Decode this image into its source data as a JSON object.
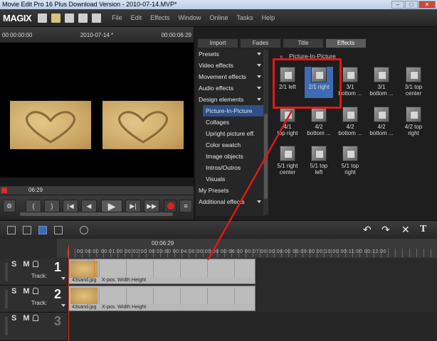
{
  "window": {
    "title": "Movie Edit Pro 16 Plus Download Version - 2010-07-14.MVP*",
    "controls": [
      "–",
      "□",
      "✕"
    ]
  },
  "app": {
    "logo": "MAGIX"
  },
  "menu": [
    "File",
    "Edit",
    "Effects",
    "Window",
    "Online",
    "Tasks",
    "Help"
  ],
  "preview": {
    "time_left": "00:00:00:00",
    "project_name": "2010-07-14 *",
    "time_right": "00:00:06:29",
    "scrub_time": "06:29"
  },
  "controls": {
    "buttons": [
      "{",
      "}",
      "|◀",
      "◀",
      "▶",
      "▶|",
      "▶▶",
      "●",
      "≡"
    ]
  },
  "browser": {
    "tabs": [
      "Import",
      "Fades",
      "Title",
      "Effects"
    ],
    "active_tab": "Effects",
    "categories": [
      {
        "label": "Presets",
        "sub": false,
        "expandable": true
      },
      {
        "label": "Video effects",
        "sub": false,
        "expandable": true
      },
      {
        "label": "Movement effects",
        "sub": false,
        "expandable": true
      },
      {
        "label": "Audio effects",
        "sub": false,
        "expandable": true
      },
      {
        "label": "Design elements",
        "sub": false,
        "expandable": true
      },
      {
        "label": "Picture-In-Picture",
        "sub": true,
        "selected": true
      },
      {
        "label": "Collages",
        "sub": true
      },
      {
        "label": "Upright picture eff.",
        "sub": true
      },
      {
        "label": "Color swatch",
        "sub": true
      },
      {
        "label": "Image objects",
        "sub": true
      },
      {
        "label": "Intros/Outros",
        "sub": true
      },
      {
        "label": "Visuals",
        "sub": true
      },
      {
        "label": "My Presets",
        "sub": false
      },
      {
        "label": "Additional effects",
        "sub": false,
        "expandable": true
      }
    ],
    "section_title": "Picture-In-Picture",
    "effects": [
      [
        "2/1 left"
      ],
      [
        "2/1 right"
      ],
      [
        "3/1",
        "bottom ..."
      ],
      [
        "3/1",
        "bottom ..."
      ],
      [
        "3/1 top",
        "center"
      ],
      [
        "4/1",
        "top right"
      ],
      [
        "4/2",
        "bottom ..."
      ],
      [
        "4/2",
        "bottom ..."
      ],
      [
        "4/2",
        "bottom ..."
      ],
      [
        "4/2 top",
        "right"
      ],
      [
        "5/1 right",
        "center"
      ],
      [
        "5/1 top",
        "left"
      ],
      [
        "5/1 top",
        "right"
      ]
    ],
    "selected_effect_index": 1
  },
  "timeline": {
    "ruler_time": "00:06:29",
    "ruler_labels": "00:00:00  00:01:00  00:02:00  00:03:00  00:04:00  00:05:00  00:06:00  00:07:00  00:08:00  00:09:00  00:10:00  00:11:00  00:12:00",
    "tracks": [
      {
        "number": "1",
        "sm": "S M",
        "label": "Track:",
        "clip_name": "43sand.jpg",
        "clip_params": "X-pos.  Width  Height"
      },
      {
        "number": "2",
        "sm": "S M",
        "label": "Track:",
        "clip_name": "43sand.jpg",
        "clip_params": "X-pos.  Width  Height"
      },
      {
        "number": "3",
        "sm": "S M",
        "label": ""
      }
    ],
    "tools_right": [
      "↶",
      "↷",
      "✕",
      "T"
    ]
  },
  "colors": {
    "accent": "#3e6bb5",
    "highlight_box": "#e01818",
    "record": "#e02020"
  }
}
